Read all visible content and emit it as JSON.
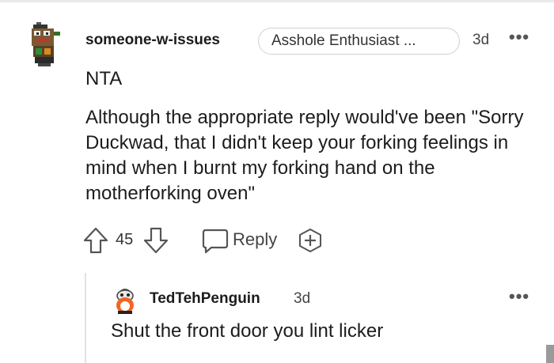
{
  "comment": {
    "username": "someone-w-issues",
    "flair": "Asshole Enthusiast ...",
    "time": "3d",
    "more_icon": "•••",
    "paragraphs": [
      "NTA",
      "Although the appropriate reply would've been \"Sorry Duckwad, that I didn't keep your forking feelings in mind when I burnt my forking hand on the motherforking oven\""
    ],
    "vote_count": "45",
    "reply_label": "Reply"
  },
  "reply": {
    "username": "TedTehPenguin",
    "time": "3d",
    "more_icon": "•••",
    "text": "Shut the front door you lint licker"
  },
  "icons": {
    "upvote": "arrow-up-outline",
    "downvote": "arrow-down-outline",
    "reply": "speech-bubble",
    "award": "plus-circle"
  }
}
